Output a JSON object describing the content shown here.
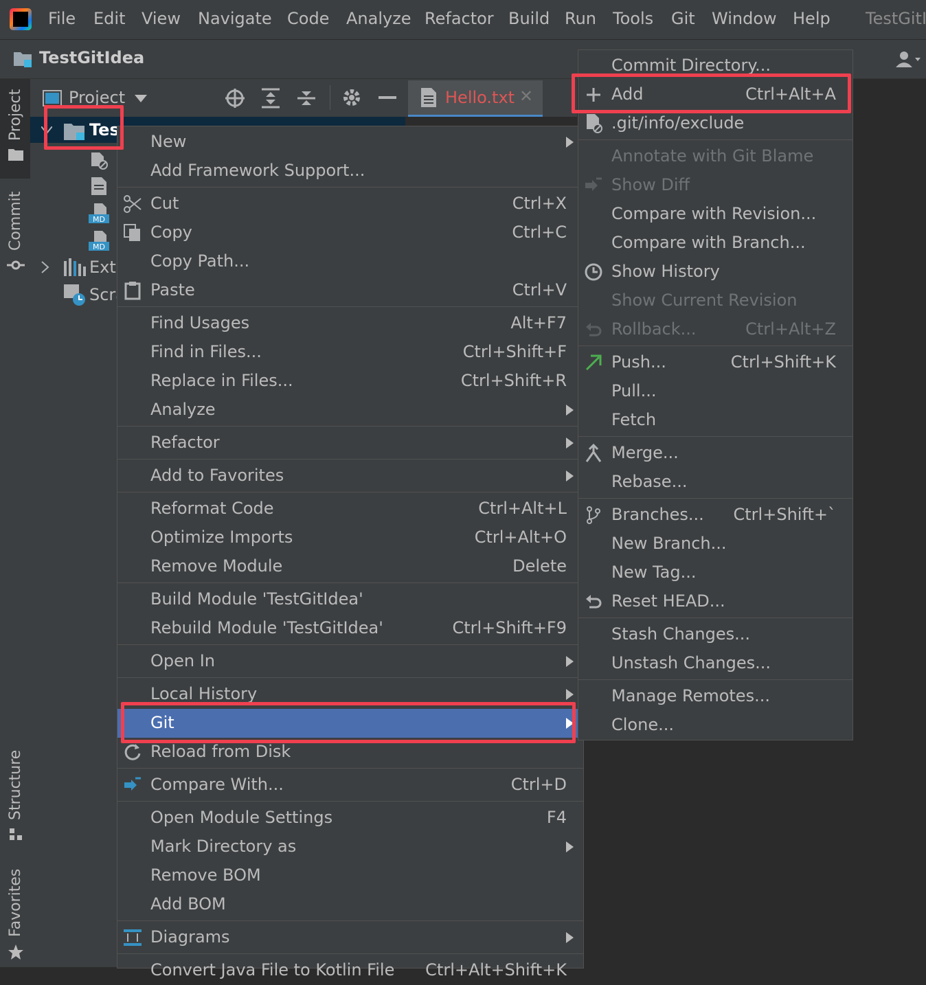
{
  "menubar": {
    "items": [
      "File",
      "Edit",
      "View",
      "Navigate",
      "Code",
      "Analyze",
      "Refactor",
      "Build",
      "Run",
      "Tools",
      "Git",
      "Window",
      "Help"
    ],
    "title": "TestGitI"
  },
  "navbar": {
    "project_name": "TestGitIdea"
  },
  "left_strip": {
    "project": "Project",
    "commit": "Commit",
    "structure": "Structure",
    "favorites": "Favorites"
  },
  "project_panel": {
    "title": "Project",
    "root_label": "Tes",
    "items": [
      "Exte",
      "Scra"
    ]
  },
  "editor_tab": {
    "label": "Hello.txt",
    "color": "#e05555"
  },
  "context_menu": {
    "items": [
      {
        "label": "New",
        "shortcut": "",
        "submenu": true
      },
      {
        "label": "Add Framework Support...",
        "shortcut": ""
      },
      {
        "label": "Cut",
        "shortcut": "Ctrl+X",
        "icon": "scissors-icon"
      },
      {
        "label": "Copy",
        "shortcut": "Ctrl+C",
        "icon": "copy-icon"
      },
      {
        "label": "Copy Path...",
        "shortcut": ""
      },
      {
        "label": "Paste",
        "shortcut": "Ctrl+V",
        "icon": "paste-icon"
      },
      {
        "label": "Find Usages",
        "shortcut": "Alt+F7"
      },
      {
        "label": "Find in Files...",
        "shortcut": "Ctrl+Shift+F"
      },
      {
        "label": "Replace in Files...",
        "shortcut": "Ctrl+Shift+R"
      },
      {
        "label": "Analyze",
        "shortcut": "",
        "submenu": true
      },
      {
        "label": "Refactor",
        "shortcut": "",
        "submenu": true
      },
      {
        "label": "Add to Favorites",
        "shortcut": "",
        "submenu": true
      },
      {
        "label": "Reformat Code",
        "shortcut": "Ctrl+Alt+L"
      },
      {
        "label": "Optimize Imports",
        "shortcut": "Ctrl+Alt+O"
      },
      {
        "label": "Remove Module",
        "shortcut": "Delete"
      },
      {
        "label": "Build Module 'TestGitIdea'",
        "shortcut": ""
      },
      {
        "label": "Rebuild Module 'TestGitIdea'",
        "shortcut": "Ctrl+Shift+F9"
      },
      {
        "label": "Open In",
        "shortcut": "",
        "submenu": true
      },
      {
        "label": "Local History",
        "shortcut": "",
        "submenu": true
      },
      {
        "label": "Git",
        "shortcut": "",
        "submenu": true,
        "highlighted": true
      },
      {
        "label": "Reload from Disk",
        "shortcut": "",
        "icon": "reload-icon"
      },
      {
        "label": "Compare With...",
        "shortcut": "Ctrl+D",
        "icon": "compare-icon"
      },
      {
        "label": "Open Module Settings",
        "shortcut": "F4"
      },
      {
        "label": "Mark Directory as",
        "shortcut": "",
        "submenu": true
      },
      {
        "label": "Remove BOM",
        "shortcut": ""
      },
      {
        "label": "Add BOM",
        "shortcut": ""
      },
      {
        "label": "Diagrams",
        "shortcut": "",
        "submenu": true,
        "icon": "diagram-icon"
      },
      {
        "label": "Convert Java File to Kotlin File",
        "shortcut": "Ctrl+Alt+Shift+K"
      }
    ]
  },
  "git_menu": {
    "items": [
      {
        "label": "Commit Directory...",
        "shortcut": ""
      },
      {
        "label": "Add",
        "shortcut": "Ctrl+Alt+A",
        "icon": "plus-icon"
      },
      {
        "label": ".git/info/exclude",
        "shortcut": "",
        "icon": "file-ignore-icon"
      },
      {
        "label": "Annotate with Git Blame",
        "shortcut": "",
        "disabled": true
      },
      {
        "label": "Show Diff",
        "shortcut": "",
        "disabled": true,
        "icon": "diff-icon"
      },
      {
        "label": "Compare with Revision...",
        "shortcut": ""
      },
      {
        "label": "Compare with Branch...",
        "shortcut": ""
      },
      {
        "label": "Show History",
        "shortcut": "",
        "icon": "clock-icon"
      },
      {
        "label": "Show Current Revision",
        "shortcut": "",
        "disabled": true
      },
      {
        "label": "Rollback...",
        "shortcut": "Ctrl+Alt+Z",
        "disabled": true,
        "icon": "rollback-icon"
      },
      {
        "label": "Push...",
        "shortcut": "Ctrl+Shift+K",
        "icon": "push-arrow-icon"
      },
      {
        "label": "Pull...",
        "shortcut": ""
      },
      {
        "label": "Fetch",
        "shortcut": ""
      },
      {
        "label": "Merge...",
        "shortcut": "",
        "icon": "merge-icon"
      },
      {
        "label": "Rebase...",
        "shortcut": ""
      },
      {
        "label": "Branches...",
        "shortcut": "Ctrl+Shift+`",
        "icon": "branch-icon"
      },
      {
        "label": "New Branch...",
        "shortcut": ""
      },
      {
        "label": "New Tag...",
        "shortcut": ""
      },
      {
        "label": "Reset HEAD...",
        "shortcut": "",
        "icon": "reset-icon"
      },
      {
        "label": "Stash Changes...",
        "shortcut": ""
      },
      {
        "label": "Unstash Changes...",
        "shortcut": ""
      },
      {
        "label": "Manage Remotes...",
        "shortcut": ""
      },
      {
        "label": "Clone...",
        "shortcut": ""
      }
    ]
  },
  "colors": {
    "highlight": "#4b6eaf",
    "annotation_box": "#f0404f",
    "push_arrow": "#4caf50"
  }
}
